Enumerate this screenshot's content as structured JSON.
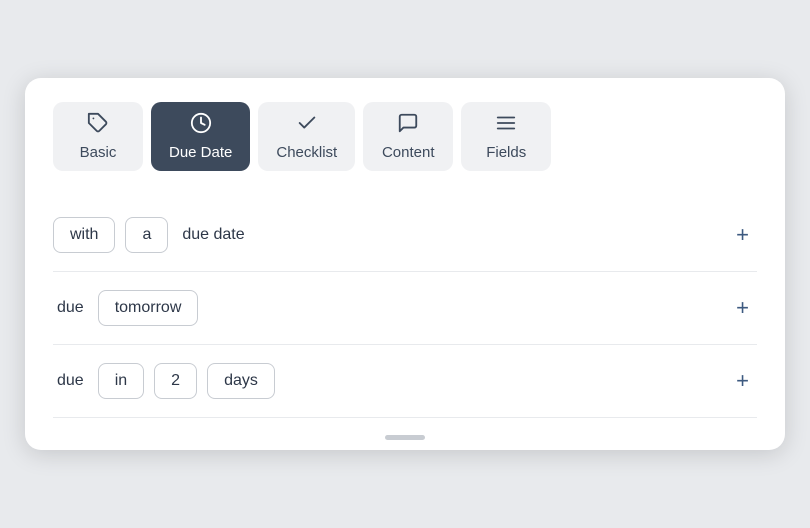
{
  "tabs": [
    {
      "id": "basic",
      "label": "Basic",
      "icon": "🏷",
      "iconType": "tag",
      "active": false
    },
    {
      "id": "due-date",
      "label": "Due Date",
      "icon": "⏰",
      "iconType": "clock",
      "active": true
    },
    {
      "id": "checklist",
      "label": "Checklist",
      "icon": "✓",
      "iconType": "check",
      "active": false
    },
    {
      "id": "content",
      "label": "Content",
      "icon": "💬",
      "iconType": "chat",
      "active": false
    },
    {
      "id": "fields",
      "label": "Fields",
      "icon": "≡",
      "iconType": "menu",
      "active": false
    }
  ],
  "rows": [
    {
      "id": "row1",
      "tokens": [
        {
          "type": "token",
          "text": "with"
        },
        {
          "type": "token",
          "text": "a"
        },
        {
          "type": "plain",
          "text": "due date"
        }
      ]
    },
    {
      "id": "row2",
      "tokens": [
        {
          "type": "plain",
          "text": "due"
        },
        {
          "type": "token",
          "text": "tomorrow"
        }
      ]
    },
    {
      "id": "row3",
      "tokens": [
        {
          "type": "plain",
          "text": "due"
        },
        {
          "type": "token",
          "text": "in"
        },
        {
          "type": "token",
          "text": "2"
        },
        {
          "type": "token",
          "text": "days"
        }
      ]
    }
  ],
  "add_button_label": "+",
  "colors": {
    "active_tab_bg": "#3d4a5c",
    "active_tab_text": "#ffffff",
    "tab_bg": "#f0f1f3",
    "add_btn_color": "#3d5a80"
  }
}
